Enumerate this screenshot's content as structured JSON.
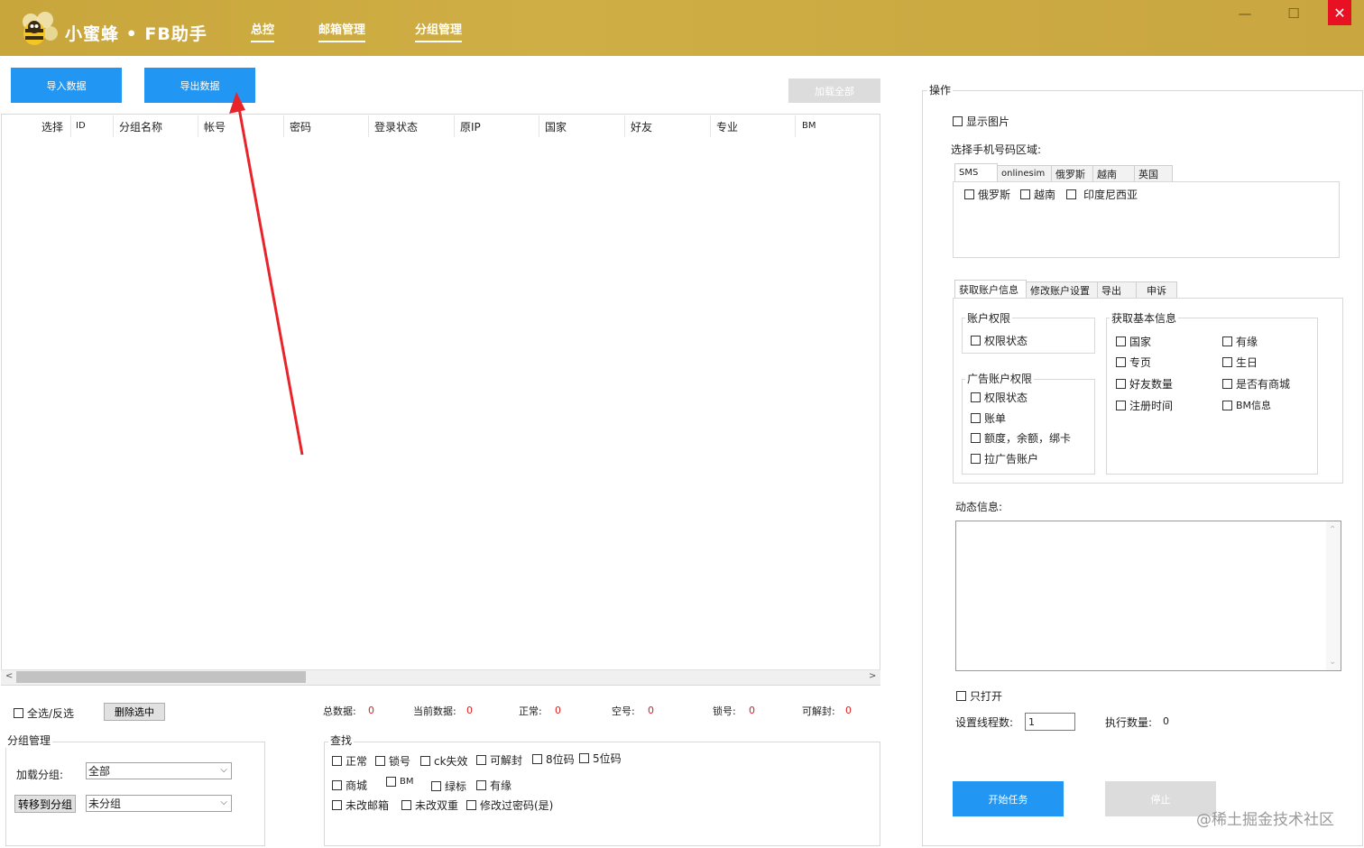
{
  "app": {
    "title": "小蜜蜂 • FB助手",
    "nav": [
      "总控",
      "邮箱管理",
      "分组管理"
    ],
    "window_controls": {
      "minimize": "—",
      "maximize": "☐",
      "close": "✕"
    }
  },
  "toolbar": {
    "import_label": "导入数据",
    "export_label": "导出数据",
    "load_all_label": "加载全部"
  },
  "table": {
    "columns": [
      "选择",
      "ID",
      "分组名称",
      "帐号",
      "密码",
      "登录状态",
      "原IP",
      "国家",
      "好友",
      "专业",
      "BM"
    ],
    "rows": []
  },
  "bottom": {
    "select_all_label": "全选/反选",
    "delete_selected_label": "删除选中",
    "stats": [
      {
        "label": "总数据:",
        "value": "0"
      },
      {
        "label": "当前数据:",
        "value": "0"
      },
      {
        "label": "正常:",
        "value": "0"
      },
      {
        "label": "空号:",
        "value": "0"
      },
      {
        "label": "锁号:",
        "value": "0"
      },
      {
        "label": "可解封:",
        "value": "0"
      }
    ],
    "group_mgmt": {
      "title": "分组管理",
      "load_group_label": "加载分组:",
      "load_group_value": "全部",
      "move_to_group_label": "转移到分组",
      "move_group_value": "未分组"
    },
    "search": {
      "title": "查找",
      "row1": [
        "正常",
        "锁号",
        "ck失效",
        "可解封",
        "8位码",
        "5位码"
      ],
      "row2": [
        "商城",
        "BM",
        "绿标",
        "有缘"
      ],
      "row3": [
        "未改邮箱",
        "未改双重",
        "修改过密码(是)"
      ]
    }
  },
  "ops": {
    "title": "操作",
    "show_image_label": "显示图片",
    "phone_region_label": "选择手机号码区域:",
    "phone_tabs": [
      "SMS",
      "onlinesim",
      "俄罗斯",
      "越南",
      "英国"
    ],
    "phone_options": [
      "俄罗斯",
      "越南",
      "印度尼西亚"
    ],
    "acct_tabs": [
      "获取账户信息",
      "修改账户设置",
      "导出",
      "申诉"
    ],
    "account_perm": {
      "title": "账户权限",
      "items": [
        "权限状态"
      ]
    },
    "ad_perm": {
      "title": "广告账户权限",
      "items": [
        "权限状态",
        "账单",
        "额度，余额，绑卡",
        "拉广告账户"
      ]
    },
    "basic_info": {
      "title": "获取基本信息",
      "col1": [
        "国家",
        "专页",
        "好友数量",
        "注册时间"
      ],
      "col2": [
        "有缘",
        "生日",
        "是否有商城",
        "BM信息"
      ]
    },
    "dynamic_info_label": "动态信息:",
    "only_open_label": "只打开",
    "threads_label": "设置线程数:",
    "threads_value": "1",
    "exec_count_label": "执行数量:",
    "exec_count_value": "0",
    "start_label": "开始任务",
    "stop_label": "停止"
  },
  "watermark": "@稀土掘金技术社区",
  "colors": {
    "titlebar": "#c9a640",
    "primary": "#2196f3",
    "annotation_arrow": "#e8242a",
    "stat_value": "#e02020"
  }
}
